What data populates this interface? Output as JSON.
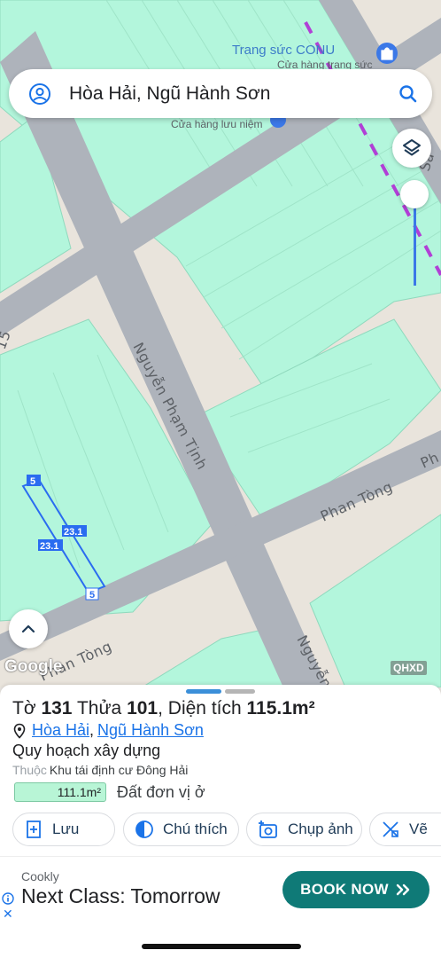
{
  "search": {
    "query": "Hòa Hải, Ngũ Hành Sơn"
  },
  "map": {
    "streets": {
      "nguyen_pham_tinh": "Nguyễn Phạm Tịnh",
      "phan_tong_1": "Phan Tòng",
      "phan_tong_2": "Phan Tòng",
      "nguyen_partial": "Nguyễn",
      "partial_15": "15",
      "partial_ph": "Ph",
      "partial_sa": "Sa"
    },
    "pois": {
      "jewelry_name": "Trang sức CONU",
      "jewelry_category": "Cửa hàng trang sức",
      "souvenir_category": "Cửa hàng lưu niệm"
    },
    "parcel_dimensions": {
      "top": "5",
      "bottom": "5",
      "left": "23.1",
      "right": "23.1"
    },
    "logo": "Google",
    "layer_tag": "QHXD",
    "colors": {
      "land": "#b3f6dc",
      "road": "#aeb3bb",
      "empty": "#e9e4dc",
      "selection": "#2a6cf0"
    }
  },
  "sheet": {
    "title_prefix": "Tờ",
    "sheet_no": "131",
    "parcel_prefix": "Thửa",
    "parcel_no": "101",
    "area_prefix": "Diện tích",
    "area": "115.1m²",
    "ward": "Hòa Hải",
    "district": "Ngũ Hành Sơn",
    "location_sep": ",",
    "plan_label": "Quy hoạch xây dựng",
    "belongs_label": "Thuộc",
    "belongs_value": "Khu tái định cư Đông Hải",
    "land_area": "111.1m²",
    "land_type": "Đất đơn vị ở",
    "actions": {
      "save": "Lưu",
      "legend": "Chú thích",
      "photo": "Chụp ảnh",
      "draw": "Vẽ"
    }
  },
  "ad": {
    "brand": "Cookly",
    "headline": "Next Class: Tomorrow",
    "cta": "BOOK NOW",
    "close": "✕"
  }
}
